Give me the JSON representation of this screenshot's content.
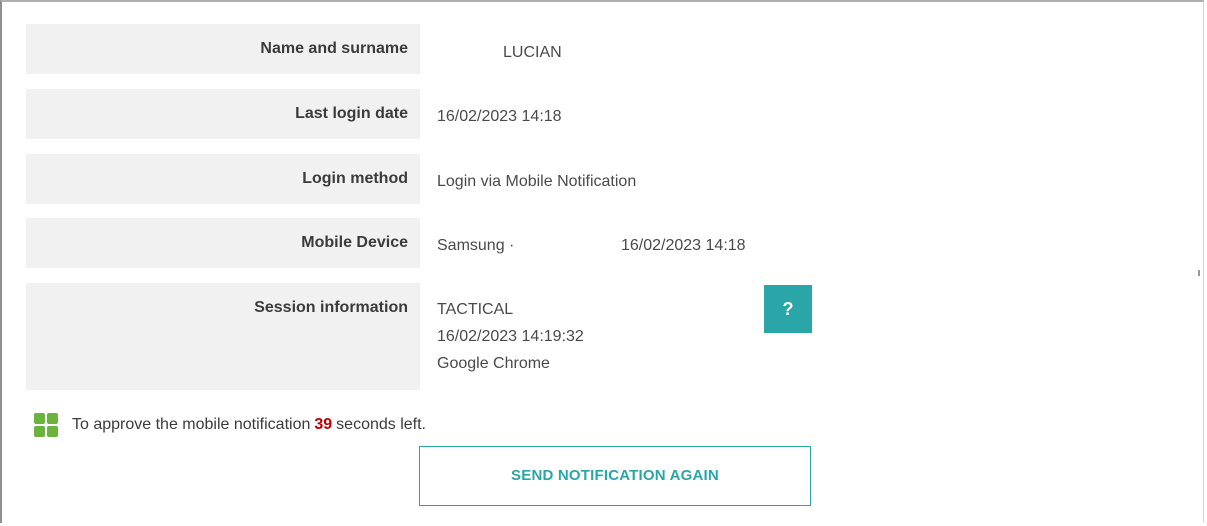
{
  "fields": {
    "name": {
      "label": "Name and surname",
      "value": "LUCIAN"
    },
    "last_login": {
      "label": "Last login date",
      "value": "16/02/2023 14:18"
    },
    "login_method": {
      "label": "Login method",
      "value": "Login via Mobile Notification"
    },
    "mobile_device": {
      "label": "Mobile Device",
      "value_brand": "Samsung ·",
      "value_date": "16/02/2023 14:18"
    },
    "session": {
      "label": "Session information",
      "line1": "TACTICAL",
      "line2": "16/02/2023 14:19:32",
      "line3": "Google Chrome"
    }
  },
  "help_button": {
    "label": "?"
  },
  "notice": {
    "text_before": "To approve the mobile notification",
    "seconds": "39",
    "text_after": "seconds left."
  },
  "send_button": {
    "label": "SEND NOTIFICATION AGAIN"
  },
  "colors": {
    "accent": "#2aa5a8",
    "countdown": "#c00000",
    "icon_green": "#6bb33d",
    "label_bg": "#f1f1f1"
  }
}
